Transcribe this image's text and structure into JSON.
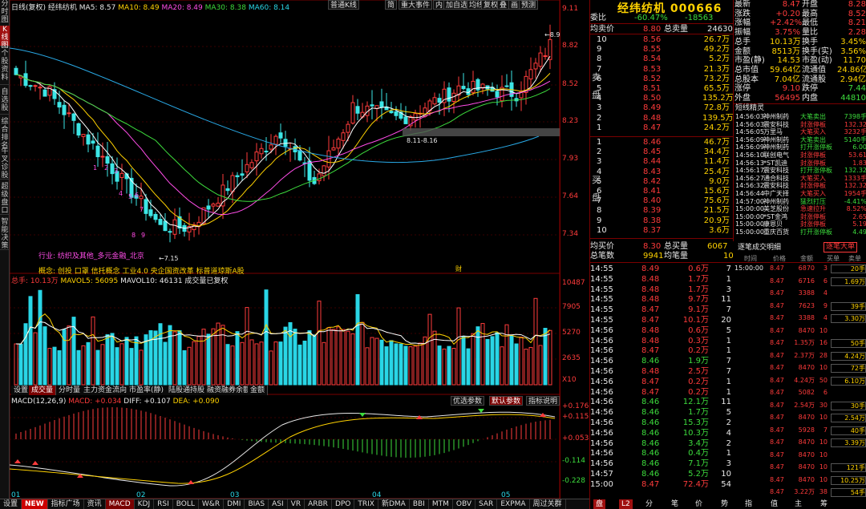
{
  "vtabs": [
    {
      "label": "分时图",
      "active": false
    },
    {
      "label": "K线图",
      "active": true
    },
    {
      "label": "个股资料",
      "active": false
    },
    {
      "label": "自选股",
      "active": false
    },
    {
      "label": "综合排名",
      "active": false
    },
    {
      "label": "牛叉诊股",
      "active": false
    },
    {
      "label": "超级盘口",
      "active": false
    },
    {
      "label": "智能决策",
      "active": false
    }
  ],
  "legend": {
    "period": "日线(复权)",
    "name": "经纬纺机",
    "ma5": "MA5: 8.57",
    "ma10": "MA10: 8.49",
    "ma20": "MA20: 8.49",
    "ma30": "MA30: 8.38",
    "ma60": "MA60: 8.14"
  },
  "toolbar": [
    "普通K线",
    "简",
    "重大事件",
    "内",
    "加自选",
    "均线",
    "复权",
    "叠",
    "画",
    "预测"
  ],
  "price_axis": [
    "9.11",
    "8.82",
    "8.52",
    "8.23",
    "7.93",
    "7.64",
    "7.34"
  ],
  "annotations": {
    "high": "8.92",
    "low": "7.15",
    "gap": "8.11-8.16",
    "industry": "行业: 纺织及其他_多元金融_北京",
    "concept": "概念: 创投  口罩  信托概念  工业4.0  央企国资改革  标普道琼斯A股",
    "badge": "财",
    "nums": [
      "1",
      "2",
      "3",
      "4",
      "5",
      "6",
      "7",
      "8",
      "9"
    ]
  },
  "volume": {
    "legend_total": "总手: 10.13万",
    "legend_mavol5": "MAVOL5: 56095",
    "legend_mavol10": "MAVOL10: 46131",
    "legend_note": "成交量已复权",
    "axis": [
      "10487",
      "7905",
      "5270",
      "2635",
      "X10"
    ]
  },
  "subtabs": [
    "设置",
    "成交量",
    "分时量",
    "主力资金流向",
    "市盈率(静)",
    "陆股通持股",
    "融资融券余额",
    "金额"
  ],
  "macd": {
    "legend_name": "MACD(12,26,9)",
    "legend_macd": "MACD: +0.034",
    "legend_diff": "DIFF: +0.107",
    "legend_dea": "DEA: +0.090",
    "buttons": [
      "优选参数",
      "默认参数",
      "指标说明"
    ],
    "axis": [
      "+0.176",
      "+0.115",
      "+0.053",
      "-0.114",
      "-0.228"
    ]
  },
  "months": [
    "01",
    "02",
    "03",
    "04",
    "05"
  ],
  "bottombar": [
    "设置",
    "NEW",
    "指标广场",
    "资讯",
    "MACD",
    "KDJ",
    "RSI",
    "BOLL",
    "W&R",
    "DMI",
    "BIAS",
    "ASI",
    "VR",
    "ARBR",
    "DPO",
    "TRIX",
    "新DMA",
    "BBI",
    "MTM",
    "OBV",
    "SAR",
    "EXPMA",
    "周过关群"
  ],
  "quote": {
    "title": "经纬纺机 000666",
    "weibi": [
      "委比",
      "-60.47%",
      "-18563"
    ],
    "avg_sell": [
      "均卖价",
      "8.80",
      "总卖量",
      "24630"
    ],
    "asks": [
      [
        "10",
        "8.56",
        "26.7万"
      ],
      [
        "9",
        "8.55",
        "49.2万"
      ],
      [
        "8",
        "8.54",
        "5.2万"
      ],
      [
        "7",
        "8.53",
        "21.3万"
      ],
      [
        "6",
        "8.52",
        "73.2万"
      ],
      [
        "5",
        "8.51",
        "65.5万"
      ],
      [
        "4",
        "8.50",
        "135.2万"
      ],
      [
        "3",
        "8.49",
        "72.8万"
      ],
      [
        "2",
        "8.48",
        "139.5万"
      ],
      [
        "1",
        "8.47",
        "24.2万"
      ]
    ],
    "bids": [
      [
        "1",
        "8.46",
        "46.7万"
      ],
      [
        "2",
        "8.45",
        "34.4万"
      ],
      [
        "3",
        "8.44",
        "11.4万"
      ],
      [
        "4",
        "8.43",
        "25.4万"
      ],
      [
        "5",
        "8.42",
        "9.0万"
      ],
      [
        "6",
        "8.41",
        "15.6万"
      ],
      [
        "7",
        "8.40",
        "75.6万"
      ],
      [
        "8",
        "8.39",
        "21.5万"
      ],
      [
        "9",
        "8.38",
        "20.9万"
      ],
      [
        "10",
        "8.37",
        "3.6万"
      ]
    ],
    "avg_buy": [
      "均买价",
      "8.30",
      "总买量",
      "6067"
    ],
    "avg_count": [
      "总笔数",
      "9941",
      "均笔量",
      "10"
    ],
    "sell_word": [
      "卖",
      "盘"
    ],
    "buy_word": [
      "买",
      "盘"
    ],
    "stats": [
      [
        "最新",
        "8.47",
        "开盘",
        "8.28"
      ],
      [
        "涨跌",
        "+0.20",
        "最高",
        "8.52"
      ],
      [
        "涨幅",
        "+2.42%",
        "最低",
        "8.21"
      ],
      [
        "振幅",
        "3.75%",
        "量比",
        "2.28"
      ],
      [
        "总手",
        "10.13万",
        "换手",
        "3.45%"
      ],
      [
        "金额",
        "8513万",
        "换手(实)",
        "3.56%"
      ],
      [
        "市盈(静)",
        "14.53",
        "市盈(动)",
        "11.70"
      ],
      [
        "总市值",
        "59.64亿",
        "流通值",
        "24.86亿"
      ],
      [
        "总股本",
        "7.04亿",
        "流通股",
        "2.94亿"
      ],
      [
        "涨停",
        "9.10",
        "跌停",
        "7.44"
      ],
      [
        "外盘",
        "56495",
        "内盘",
        "44810"
      ]
    ],
    "news_title": "短线精灵",
    "news": [
      [
        "14:56:03",
        "神州制药",
        "大笔卖出",
        "7398手"
      ],
      [
        "14:56:03",
        "震安科技",
        "封涨停板",
        "132.32"
      ],
      [
        "14:56:05",
        "万里马",
        "大笔买入",
        "3232手"
      ],
      [
        "14:56:09",
        "神州制药",
        "大笔卖出",
        "5140手"
      ],
      [
        "14:56:09",
        "神州制药",
        "打开涨停板",
        "6.00"
      ],
      [
        "14:56:10",
        "联创电气",
        "封涨停板",
        "53.61"
      ],
      [
        "14:56:13",
        "*ST凯迪",
        "封涨停板",
        "1.83"
      ],
      [
        "14:56:17",
        "震安科技",
        "打开涨停板",
        "132.32"
      ],
      [
        "14:56:27",
        "通合科技",
        "大笔买入",
        "1333手"
      ],
      [
        "14:56:32",
        "震安科技",
        "封涨停板",
        "132.32"
      ],
      [
        "14:56:44",
        "中广天择",
        "大笔买入",
        "1954手"
      ],
      [
        "14:57:00",
        "神州制药",
        "猛烈打压",
        "-4.41%"
      ],
      [
        "15:00:00",
        "美芝股份",
        "急速拉升",
        "8.52%"
      ],
      [
        "15:00:00",
        "*ST金鸿",
        "封涨停板",
        "2.65"
      ],
      [
        "15:00:00",
        "康恩贝",
        "封涨停板",
        "5.19"
      ],
      [
        "15:00:00",
        "重庆百货",
        "打开涨停板",
        "4.49"
      ]
    ],
    "trade_title": "逐笔成交明细",
    "trade_btn": "逐笔大单",
    "trades": [
      [
        "14:55",
        "8.49",
        "0.6万",
        "7"
      ],
      [
        "14:55",
        "8.48",
        "1.7万",
        "1"
      ],
      [
        "14:55",
        "8.48",
        "1.7万",
        "3"
      ],
      [
        "14:55",
        "8.48",
        "9.7万",
        "11"
      ],
      [
        "14:55",
        "8.47",
        "9.1万",
        "7"
      ],
      [
        "14:55",
        "8.47",
        "10.1万",
        "20"
      ],
      [
        "14:56",
        "8.48",
        "0.6万",
        "5"
      ],
      [
        "14:56",
        "8.48",
        "0.3万",
        "1"
      ],
      [
        "14:56",
        "8.47",
        "0.2万",
        "1"
      ],
      [
        "14:56",
        "8.46",
        "1.9万",
        "7"
      ],
      [
        "14:56",
        "8.48",
        "2.5万",
        "7"
      ],
      [
        "14:56",
        "8.47",
        "0.2万",
        "1"
      ],
      [
        "14:56",
        "8.47",
        "0.2万",
        "1"
      ],
      [
        "14:56",
        "8.46",
        "12.1万",
        "11"
      ],
      [
        "14:56",
        "8.46",
        "1.7万",
        "5"
      ],
      [
        "14:56",
        "8.46",
        "15.3万",
        "2"
      ],
      [
        "14:56",
        "8.46",
        "10.3万",
        "4"
      ],
      [
        "14:56",
        "8.46",
        "3.4万",
        "2"
      ],
      [
        "14:56",
        "8.46",
        "0.4万",
        "1"
      ],
      [
        "14:56",
        "8.46",
        "7.1万",
        "3"
      ],
      [
        "14:57",
        "8.46",
        "5.2万",
        "10"
      ],
      [
        "15:00",
        "8.47",
        "72.4万",
        "54"
      ]
    ],
    "detail_header": [
      "时间",
      "价格",
      "金额",
      "买单",
      "卖单"
    ],
    "detail": [
      [
        "15:00:00",
        "8.47",
        "6870",
        "3",
        "20手"
      ],
      [
        "",
        "8.47",
        "6716",
        "6",
        "1.69万"
      ],
      [
        "",
        "8.47",
        "3388",
        "4",
        ""
      ],
      [
        "",
        "8.47",
        "7623",
        "9",
        "39手"
      ],
      [
        "",
        "8.47",
        "3388",
        "4",
        "3.30万"
      ],
      [
        "",
        "8.47",
        "8470",
        "10",
        ""
      ],
      [
        "",
        "8.47",
        "1.35万",
        "16",
        "50手"
      ],
      [
        "",
        "8.47",
        "2.37万",
        "28",
        "4.24万"
      ],
      [
        "",
        "8.47",
        "8470",
        "10",
        "72手"
      ],
      [
        "",
        "8.47",
        "4.24万",
        "50",
        "6.10万"
      ],
      [
        "",
        "8.47",
        "5082",
        "6",
        ""
      ],
      [
        "",
        "8.47",
        "2.54万",
        "30",
        "30手"
      ],
      [
        "",
        "8.47",
        "8470",
        "10",
        "2.54万"
      ],
      [
        "",
        "8.47",
        "5928",
        "7",
        "40手"
      ],
      [
        "",
        "8.47",
        "8470",
        "10",
        "3.39万"
      ],
      [
        "",
        "8.47",
        "8470",
        "10",
        ""
      ],
      [
        "",
        "8.47",
        "8470",
        "10",
        "121手"
      ],
      [
        "",
        "8.47",
        "8470",
        "10",
        "10.25万"
      ],
      [
        "",
        "8.47",
        "3.22万",
        "38",
        "54手"
      ]
    ],
    "bottom_tabs": [
      "盘",
      "L2",
      "分",
      "笔",
      "价",
      "势",
      "指",
      "值",
      "主",
      "筹"
    ]
  }
}
